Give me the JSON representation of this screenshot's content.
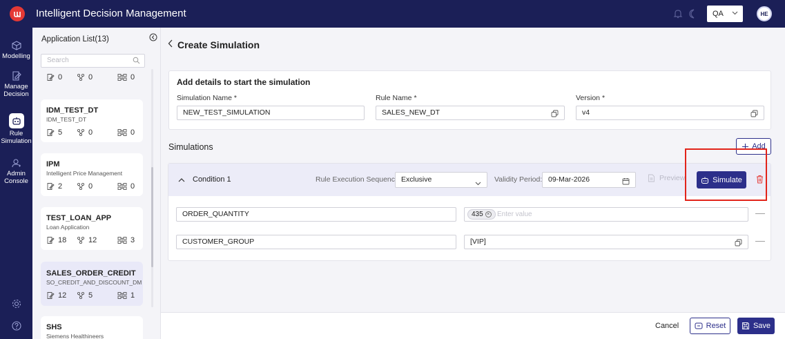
{
  "header": {
    "app_title": "Intelligent Decision Management",
    "env": "QA",
    "avatar": "HE"
  },
  "nav": {
    "items": [
      {
        "label": "Modelling",
        "icon": "cube-icon"
      },
      {
        "label": "Manage Decision",
        "icon": "edit-doc-icon"
      },
      {
        "label": "Rule Simulation",
        "icon": "robot-icon"
      },
      {
        "label": "Admin Console",
        "icon": "admin-icon"
      }
    ],
    "settings_icon": "settings-icon",
    "help_icon": "help-icon"
  },
  "applist": {
    "title": "Application List(13)",
    "search_placeholder": "Search",
    "cards": [
      {
        "name": "",
        "sub": "",
        "docs": "0",
        "flows": "0",
        "nodes": "0"
      },
      {
        "name": "IDM_TEST_DT",
        "sub": "IDM_TEST_DT",
        "docs": "5",
        "flows": "0",
        "nodes": "0"
      },
      {
        "name": "IPM",
        "sub": "Intelligent Price Management",
        "docs": "2",
        "flows": "0",
        "nodes": "0"
      },
      {
        "name": "TEST_LOAN_APP",
        "sub": "Loan Application",
        "docs": "18",
        "flows": "12",
        "nodes": "3"
      },
      {
        "name": "SALES_ORDER_CREDIT",
        "sub": "SO_CREDIT_AND_DISCOUNT_DM",
        "docs": "12",
        "flows": "5",
        "nodes": "1"
      },
      {
        "name": "SHS",
        "sub": "Siemens Healthineers",
        "docs": "",
        "flows": "",
        "nodes": ""
      }
    ]
  },
  "page": {
    "title": "Create Simulation",
    "details_title": "Add details to start the simulation",
    "sim_name_label": "Simulation Name *",
    "sim_name_value": "NEW_TEST_SIMULATION",
    "rule_name_label": "Rule Name *",
    "rule_name_value": "SALES_NEW_DT",
    "version_label": "Version *",
    "version_value": "v4",
    "simulations_label": "Simulations",
    "add_label": "Add"
  },
  "condition": {
    "title": "Condition 1",
    "res_label": "Rule Execution Sequence:",
    "res_value": "Exclusive",
    "validity_label": "Validity Period:",
    "validity_value": "09-Mar-2026",
    "preview_label": "Preview",
    "simulate_label": "Simulate",
    "rows": [
      {
        "field": "ORDER_QUANTITY",
        "chip": "435",
        "placeholder": "Enter value"
      },
      {
        "field": "CUSTOMER_GROUP",
        "value": "[VIP]"
      }
    ]
  },
  "footer": {
    "cancel": "Cancel",
    "reset": "Reset",
    "save": "Save"
  },
  "colors": {
    "brand": "#1b1f57",
    "primary": "#2c2f8a",
    "highlight": "#e2231a"
  }
}
